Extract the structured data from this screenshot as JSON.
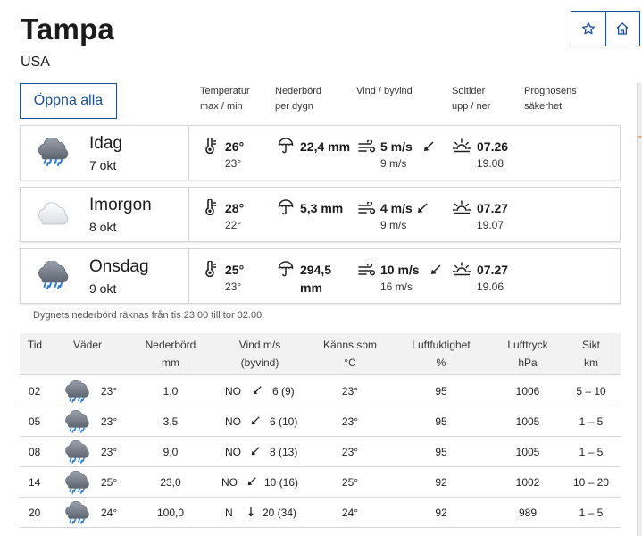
{
  "header": {
    "city": "Tampa",
    "country": "USA",
    "favorite_icon": "star-icon",
    "home_icon": "home-icon"
  },
  "open_all_label": "Öppna alla",
  "summary_headers": {
    "temperature": [
      "Temperatur",
      "max / min"
    ],
    "precipitation": [
      "Nederbörd",
      "per dygn"
    ],
    "wind": [
      "Vind / byvind"
    ],
    "sun": [
      "Soltider",
      "upp / ner"
    ],
    "certainty": [
      "Prognosens",
      "säkerhet"
    ]
  },
  "days": [
    {
      "name": "Idag",
      "date": "7 okt",
      "weather_icon": "rain-cloud-icon",
      "temp_max": "26°",
      "temp_min": "23°",
      "precip": "22,4 mm",
      "wind": "5 m/s",
      "gust": "9 m/s",
      "sunrise": "07.26",
      "sunset": "19.08"
    },
    {
      "name": "Imorgon",
      "date": "8 okt",
      "weather_icon": "cloud-icon",
      "temp_max": "28°",
      "temp_min": "22°",
      "precip": "5,3 mm",
      "wind": "4 m/s",
      "gust": "9 m/s",
      "sunrise": "07.27",
      "sunset": "19.07"
    },
    {
      "name": "Onsdag",
      "date": "9 okt",
      "weather_icon": "rain-cloud-icon",
      "temp_max": "25°",
      "temp_min": "23°",
      "precip": "294,5",
      "precip_unit": "mm",
      "wind": "10 m/s",
      "gust": "16 m/s",
      "sunrise": "07.27",
      "sunset": "19.06"
    }
  ],
  "precip_note": "Dygnets nederbörd räknas från tis 23.00 till tor 02.00.",
  "table": {
    "columns": [
      [
        "Tid"
      ],
      [
        "Väder"
      ],
      [
        "Nederbörd",
        "mm"
      ],
      [
        "Vind m/s",
        "(byvind)"
      ],
      [
        "Känns som",
        "°C"
      ],
      [
        "Luftfuktighet",
        "%"
      ],
      [
        "Lufttryck",
        "hPa"
      ],
      [
        "Sikt",
        "km"
      ]
    ],
    "rows": [
      {
        "time": "02",
        "icon": "rain-cloud-icon",
        "temp": "23°",
        "precip": "1,0",
        "wind_dir": "NO",
        "wind": "6 (9)",
        "feels": "23°",
        "humidity": "95",
        "pressure": "1006",
        "visibility": "5 – 10"
      },
      {
        "time": "05",
        "icon": "rain-cloud-icon",
        "temp": "23°",
        "precip": "3,5",
        "wind_dir": "NO",
        "wind": "6 (10)",
        "feels": "23°",
        "humidity": "95",
        "pressure": "1005",
        "visibility": "1 – 5"
      },
      {
        "time": "08",
        "icon": "rain-cloud-icon",
        "temp": "23°",
        "precip": "9,0",
        "wind_dir": "NO",
        "wind": "8 (13)",
        "feels": "23°",
        "humidity": "95",
        "pressure": "1005",
        "visibility": "1 – 5"
      },
      {
        "time": "14",
        "icon": "rain-cloud-icon",
        "temp": "25°",
        "precip": "23,0",
        "wind_dir": "NO",
        "wind": "10 (16)",
        "feels": "25°",
        "humidity": "92",
        "pressure": "1002",
        "visibility": "10 – 20"
      },
      {
        "time": "20",
        "icon": "rain-cloud-icon",
        "temp": "24°",
        "precip": "100,0",
        "wind_dir": "N",
        "wind": "20 (34)",
        "feels": "24°",
        "humidity": "92",
        "pressure": "989",
        "visibility": "1 – 5"
      }
    ]
  },
  "colors": {
    "accent": "#1a4f9c",
    "border": "#d4d4d4",
    "header_bg": "#f2f2f2"
  }
}
